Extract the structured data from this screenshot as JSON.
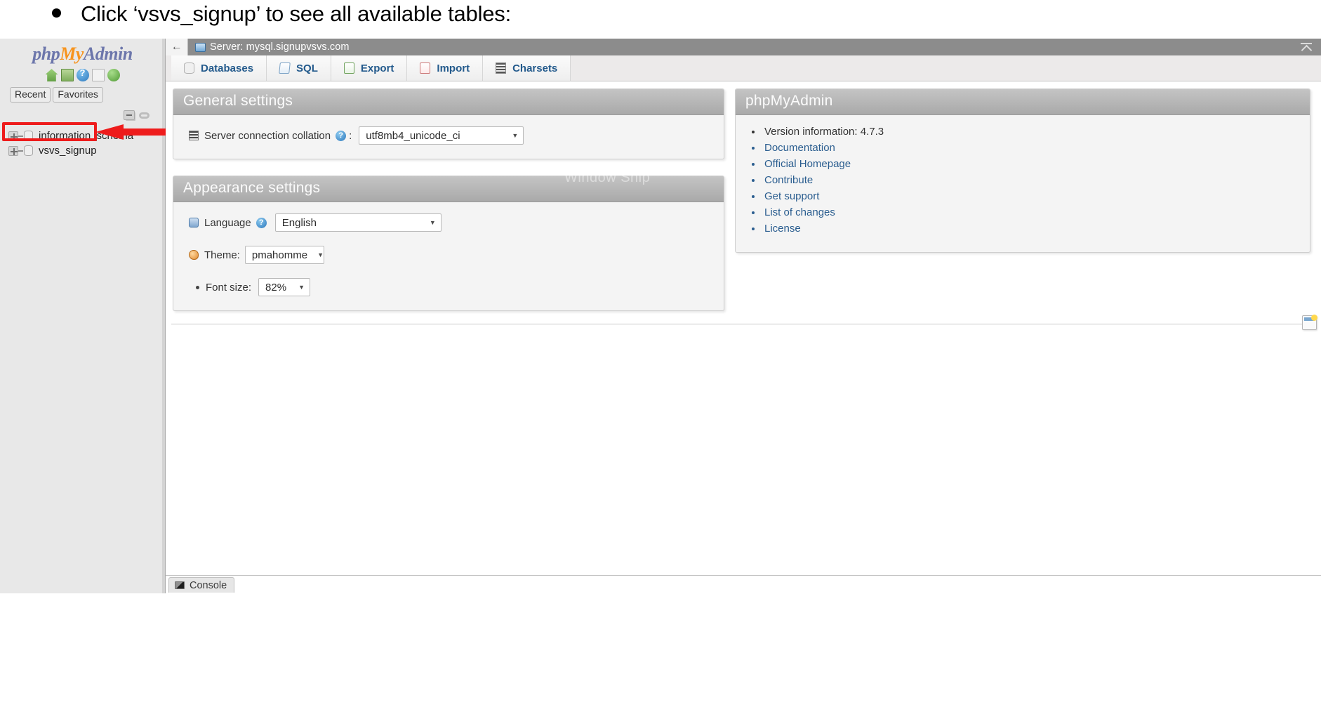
{
  "slide": {
    "bullet_text": "Click ‘vsvs_signup’ to see all available tables:"
  },
  "navigation": {
    "logo": {
      "php": "php",
      "my": "My",
      "admin": "Admin"
    },
    "icons": [
      {
        "name": "home-icon",
        "label": "Home"
      },
      {
        "name": "logout-icon",
        "label": "Log out"
      },
      {
        "name": "help-icon",
        "label": "phpMyAdmin documentation"
      },
      {
        "name": "documentation-icon",
        "label": "Documentation"
      },
      {
        "name": "reload-icon",
        "label": "Reload navigation panel"
      }
    ],
    "quick_buttons": [
      {
        "label": "Recent"
      },
      {
        "label": "Favorites"
      }
    ],
    "collapse_icons": [
      {
        "name": "collapse-all-icon"
      },
      {
        "name": "toggle-link-icon"
      }
    ],
    "databases": [
      {
        "label": "information_schema",
        "expanded": false
      },
      {
        "label": "vsvs_signup",
        "expanded": false,
        "highlighted": true
      }
    ]
  },
  "serverbar": {
    "back_label": "←",
    "title": "Server: mysql.signupvsvs.com",
    "collapse_icon": "chevron-up-collapse-icon"
  },
  "tabs": [
    {
      "label": "Databases",
      "icon": "databases-icon"
    },
    {
      "label": "SQL",
      "icon": "sql-icon"
    },
    {
      "label": "Export",
      "icon": "export-icon"
    },
    {
      "label": "Import",
      "icon": "import-icon"
    },
    {
      "label": "Charsets",
      "icon": "charsets-icon"
    }
  ],
  "general_settings": {
    "title": "General settings",
    "collation_label": "Server connection collation",
    "collation_help": "?",
    "collation_colon": ":",
    "collation_value": "utf8mb4_unicode_ci"
  },
  "appearance_settings": {
    "title": "Appearance settings",
    "language_label": "Language",
    "language_help": "?",
    "language_value": "English",
    "theme_label": "Theme:",
    "theme_value": "pmahomme",
    "fontsize_label": "Font size:",
    "fontsize_value": "82%"
  },
  "pma_panel": {
    "title": "phpMyAdmin",
    "links": [
      {
        "label": "Version information: 4.7.3",
        "is_link": false
      },
      {
        "label": "Documentation",
        "is_link": true
      },
      {
        "label": "Official Homepage",
        "is_link": true
      },
      {
        "label": "Contribute",
        "is_link": true
      },
      {
        "label": "Get support",
        "is_link": true
      },
      {
        "label": "List of changes",
        "is_link": true
      },
      {
        "label": "License",
        "is_link": true
      }
    ]
  },
  "watermark": {
    "text": "Window Snip"
  },
  "console": {
    "label": "Console",
    "icon": "console-icon"
  },
  "note_icon": {
    "name": "new-window-note-icon"
  },
  "colors": {
    "annotation_red": "#ee1c1c",
    "link_blue": "#2a5d8f",
    "tab_text": "#235a8c",
    "panel_header": "#b3b3b3",
    "server_bar": "#8c8c8c"
  }
}
